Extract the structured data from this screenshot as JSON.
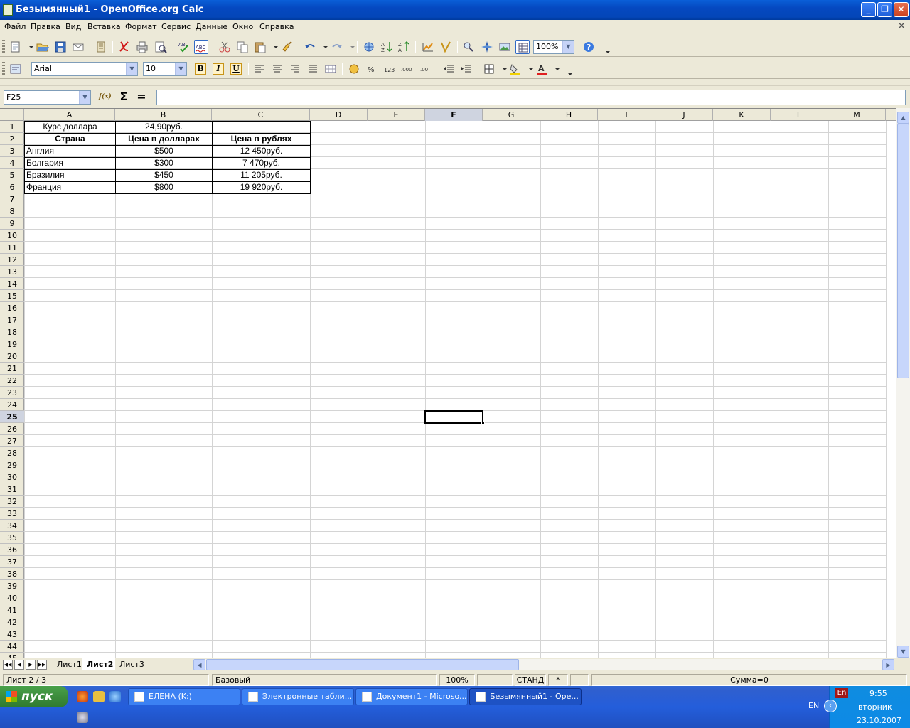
{
  "window": {
    "title": "Безымянный1 - OpenOffice.org Calc"
  },
  "menu": [
    "Файл",
    "Правка",
    "Вид",
    "Вставка",
    "Формат",
    "Сервис",
    "Данные",
    "Окно",
    "Справка"
  ],
  "toolbar": {
    "zoom": "100%",
    "font_name": "Arial",
    "font_size": "10",
    "bold": "B",
    "italic": "I",
    "underline": "U"
  },
  "formula_bar": {
    "name_box": "F25",
    "function_wizard": "f(x)",
    "sum": "Σ",
    "equals": "=",
    "formula": ""
  },
  "columns": [
    "A",
    "B",
    "C",
    "D",
    "E",
    "F",
    "G",
    "H",
    "I",
    "J",
    "K",
    "L",
    "M"
  ],
  "selected_column": "F",
  "selected_row": "25",
  "row_count": 44,
  "cells": {
    "A1": "Курс доллара",
    "B1": "24,90руб.",
    "A2": "Страна",
    "B2": "Цена в долларах",
    "C2": "Цена в рублях",
    "A3": "Англия",
    "B3": "$500",
    "C3": "12 450руб.",
    "A4": "Болгария",
    "B4": "$300",
    "C4": "7 470руб.",
    "A5": "Бразилия",
    "B5": "$450",
    "C5": "11 205руб.",
    "A6": "Франция",
    "B6": "$800",
    "C6": "19 920руб."
  },
  "sheets": [
    "Лист1",
    "Лист2",
    "Лист3"
  ],
  "active_sheet": "Лист2",
  "status": {
    "sheet": "Лист 2 / 3",
    "style": "Базовый",
    "zoom": "100%",
    "mode": "СТАНД",
    "modified": "*",
    "sum": "Сумма=0"
  },
  "taskbar": {
    "start": "пуск",
    "tasks": [
      "ЕЛЕНА (K:)",
      "Электронные табли...",
      "Документ1 - Microso...",
      "Безымянный1 - Ope..."
    ],
    "active_task": 3,
    "lang_indicator": "En",
    "lang": "EN",
    "time": "9:55",
    "day": "вторник",
    "date": "23.10.2007"
  }
}
